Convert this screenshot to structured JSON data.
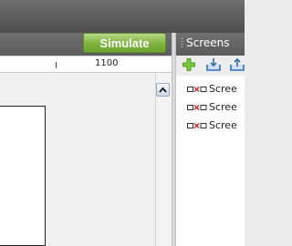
{
  "toolbar": {
    "simulate_label": "Simulate"
  },
  "ruler": {
    "value": "1100"
  },
  "screens_panel": {
    "title": "Screens",
    "tools": [
      "add-icon",
      "import-icon",
      "export-icon"
    ],
    "items": [
      {
        "label": "Scree",
        "icon": "screen-link-icon"
      },
      {
        "label": "Scree",
        "icon": "screen-link-icon"
      },
      {
        "label": "Scree",
        "icon": "screen-link-icon"
      }
    ]
  },
  "colors": {
    "simulate_green": "#7eb33e",
    "header_gray": "#5c5c5c",
    "screen_icon_red": "#d03030"
  }
}
